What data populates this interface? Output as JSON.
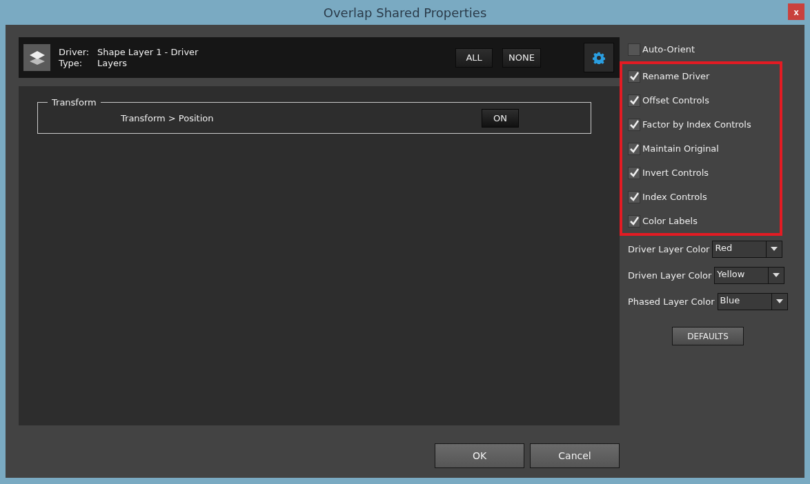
{
  "window": {
    "title": "Overlap Shared Properties",
    "close": "x"
  },
  "header": {
    "driver_label": "Driver:",
    "driver_value": "Shape Layer 1 - Driver",
    "type_label": "Type:",
    "type_value": "Layers",
    "buttons": [
      "ALL",
      "NONE"
    ]
  },
  "groups": [
    {
      "title": "Transform",
      "rows": [
        {
          "label": "Transform > Position",
          "toggle": "ON"
        }
      ]
    }
  ],
  "options": [
    {
      "label": "Auto-Orient",
      "checked": false
    }
  ],
  "highlighted_options": [
    {
      "label": "Rename Driver",
      "checked": true
    },
    {
      "label": "Offset Controls",
      "checked": true
    },
    {
      "label": "Factor by Index Controls",
      "checked": true
    },
    {
      "label": "Maintain Original",
      "checked": true
    },
    {
      "label": "Invert Controls",
      "checked": true
    },
    {
      "label": "Index Controls",
      "checked": true
    },
    {
      "label": "Color Labels",
      "checked": true
    }
  ],
  "color_selects": [
    {
      "label": "Driver Layer Color",
      "value": "Red"
    },
    {
      "label": "Driven Layer Color",
      "value": "Yellow"
    },
    {
      "label": "Phased Layer Color",
      "value": "Blue"
    }
  ],
  "defaults_button": "DEFAULTS",
  "footer_buttons": [
    "OK",
    "Cancel"
  ]
}
